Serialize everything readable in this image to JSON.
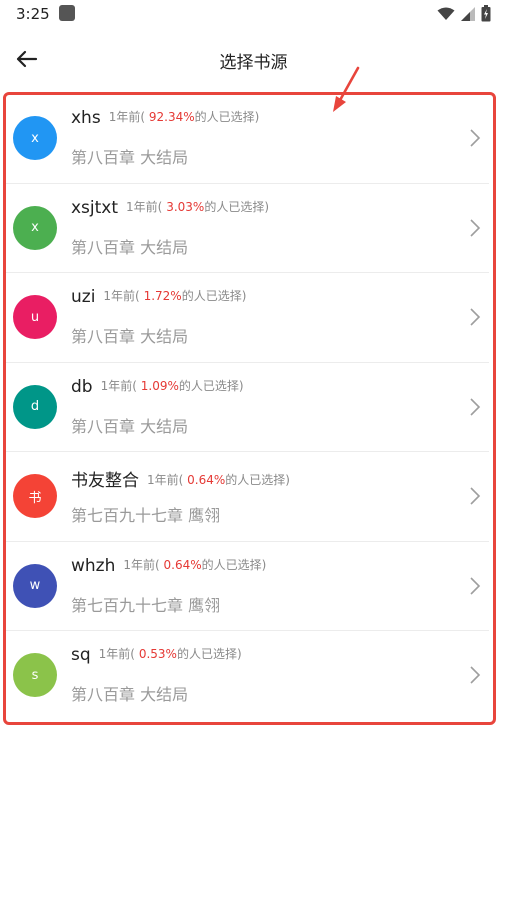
{
  "status": {
    "time": "3:25"
  },
  "header": {
    "title": "选择书源"
  },
  "colors": {
    "highlight": "#e8453c",
    "accent_percent": "#e53935"
  },
  "sources": [
    {
      "avatar_letter": "x",
      "avatar_color": "#2196f3",
      "name": "xhs",
      "meta_prefix": "1年前(",
      "percent": "92.34%",
      "meta_suffix": "的人已选择)",
      "chapter": "第八百章 大结局"
    },
    {
      "avatar_letter": "x",
      "avatar_color": "#4caf50",
      "name": "xsjtxt",
      "meta_prefix": "1年前(",
      "percent": "3.03%",
      "meta_suffix": "的人已选择)",
      "chapter": "第八百章 大结局"
    },
    {
      "avatar_letter": "u",
      "avatar_color": "#e91e63",
      "name": "uzi",
      "meta_prefix": "1年前(",
      "percent": "1.72%",
      "meta_suffix": "的人已选择)",
      "chapter": "第八百章 大结局"
    },
    {
      "avatar_letter": "d",
      "avatar_color": "#009688",
      "name": "db",
      "meta_prefix": "1年前(",
      "percent": "1.09%",
      "meta_suffix": "的人已选择)",
      "chapter": "第八百章 大结局"
    },
    {
      "avatar_letter": "书",
      "avatar_color": "#f44336",
      "name": "书友整合",
      "meta_prefix": "1年前(",
      "percent": "0.64%",
      "meta_suffix": "的人已选择)",
      "chapter": "第七百九十七章 鹰翎"
    },
    {
      "avatar_letter": "w",
      "avatar_color": "#3f51b5",
      "name": "whzh",
      "meta_prefix": "1年前(",
      "percent": "0.64%",
      "meta_suffix": "的人已选择)",
      "chapter": "第七百九十七章 鹰翎"
    },
    {
      "avatar_letter": "s",
      "avatar_color": "#8bc34a",
      "name": "sq",
      "meta_prefix": "1年前(",
      "percent": "0.53%",
      "meta_suffix": "的人已选择)",
      "chapter": "第八百章 大结局"
    }
  ]
}
